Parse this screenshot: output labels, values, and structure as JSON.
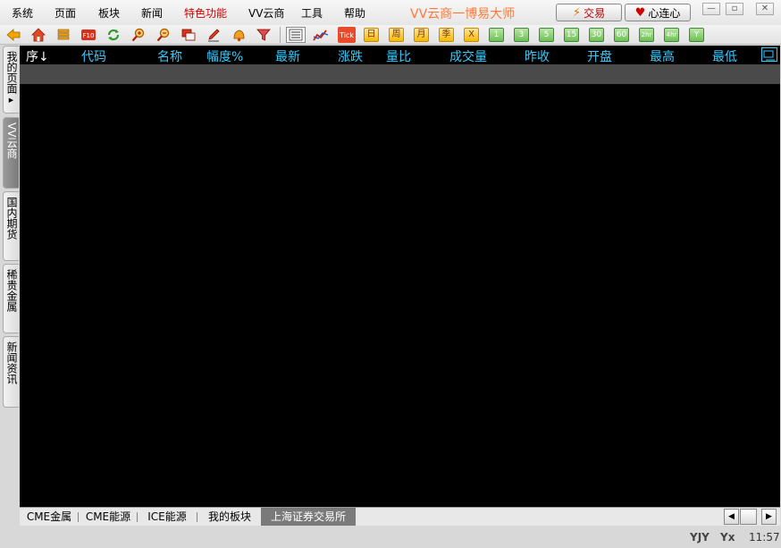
{
  "menu": {
    "items": [
      {
        "label": "系统",
        "special": false
      },
      {
        "label": "页面",
        "special": false
      },
      {
        "label": "板块",
        "special": false
      },
      {
        "label": "新闻",
        "special": false
      },
      {
        "label": "特色功能",
        "special": true
      },
      {
        "label": "VV云商",
        "special": false
      },
      {
        "label": "工具",
        "special": false
      },
      {
        "label": "帮助",
        "special": false
      }
    ],
    "app_title": "VV云商一博易大师",
    "trade_button": "交易",
    "xinlianxin_button": "心连心",
    "window_controls": {
      "minimize": "—",
      "restore": "▫",
      "close": "✕"
    }
  },
  "toolbar": {
    "icons": [
      "back-arrow-icon",
      "home-icon",
      "coins-icon",
      "f10-icon",
      "refresh-icon",
      "zoom-in-icon",
      "zoom-out-icon",
      "window-icon",
      "pencil-icon",
      "bell-icon",
      "filter-icon",
      "list-view-icon",
      "line-chart-icon"
    ],
    "tick_label": "Tick",
    "calendar_buttons": [
      "日",
      "周",
      "月",
      "季",
      "X"
    ],
    "period_buttons": [
      "1",
      "3",
      "5",
      "15",
      "30",
      "60",
      "2hr",
      "4hr",
      "Y"
    ]
  },
  "side_tabs": [
    {
      "label": "我的页面",
      "arrow": "▶",
      "active": false
    },
    {
      "label": "VV云商",
      "active": true
    },
    {
      "label": "国内期货",
      "active": false
    },
    {
      "label": "稀贵金属",
      "active": false
    },
    {
      "label": "新闻资讯",
      "active": false
    }
  ],
  "grid": {
    "columns": [
      "序↓",
      "代码",
      "名称",
      "幅度%",
      "最新",
      "涨跌",
      "量比",
      "成交量",
      "昨收",
      "开盘",
      "最高",
      "最低"
    ],
    "header_color": "#33ccff",
    "rows": []
  },
  "bottom_tabs": {
    "tabs": [
      {
        "label": "CME金属",
        "active": false
      },
      {
        "label": "CME能源",
        "active": false
      },
      {
        "label": "ICE能源",
        "active": false
      },
      {
        "label": "我的板块",
        "active": false
      },
      {
        "label": "上海证券交易所",
        "active": true
      }
    ],
    "scroll_left": "◀",
    "scroll_right": "▶"
  },
  "statusbar": {
    "yjy": "YJY",
    "filter_glyph": "Yx",
    "time": "11:57"
  },
  "colors": {
    "title": "#ff7a3a",
    "special_menu": "#d40000",
    "grid_bg": "#000000",
    "header_text": "#33ccff"
  }
}
